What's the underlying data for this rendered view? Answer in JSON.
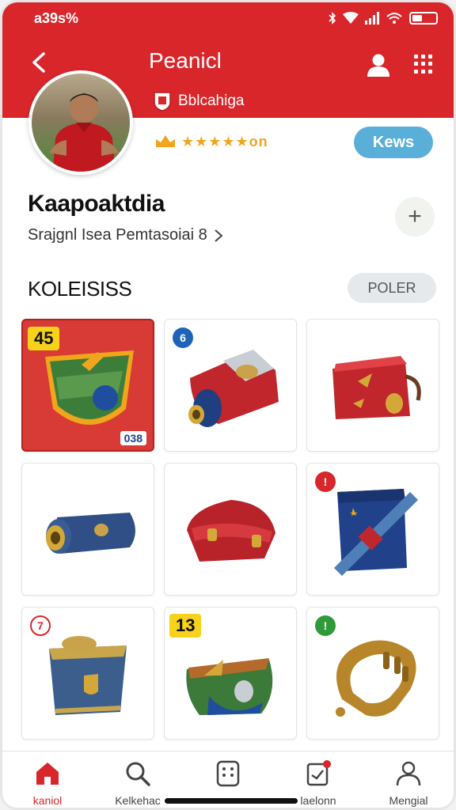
{
  "status": {
    "time": "a39s%"
  },
  "header": {
    "title": "Peanicl",
    "club_name": "Bblcahiga",
    "rating_text": "★★★★★on",
    "news_label": "Kews"
  },
  "profile": {
    "name": "Kaapoaktdia",
    "subtitle": "Srajgnl Isea Pemtasoiai 8"
  },
  "collection": {
    "title": "KOLEISISS",
    "filter_label": "POLER",
    "items": [
      {
        "price": "45",
        "count": "038"
      },
      {
        "badge": "6",
        "badge_color": "#1e63b8"
      },
      {},
      {},
      {},
      {
        "badge": "!",
        "badge_color": "#d9262b"
      },
      {
        "badge": "7",
        "badge_color": "#d9262b"
      },
      {
        "price": "13"
      },
      {
        "badge": "!",
        "badge_color": "#2f9a3a"
      }
    ]
  },
  "nav": [
    {
      "label": "kaniol",
      "icon": "home-icon"
    },
    {
      "label": "Kelkehac",
      "icon": "search-icon"
    },
    {
      "label": "",
      "icon": "collection-icon"
    },
    {
      "label": "laelonn",
      "icon": "notification-icon"
    },
    {
      "label": "Mengial",
      "icon": "profile-icon"
    }
  ],
  "colors": {
    "brand": "#d9262b",
    "accent": "#5aafd9",
    "gold": "#f0a51b"
  }
}
